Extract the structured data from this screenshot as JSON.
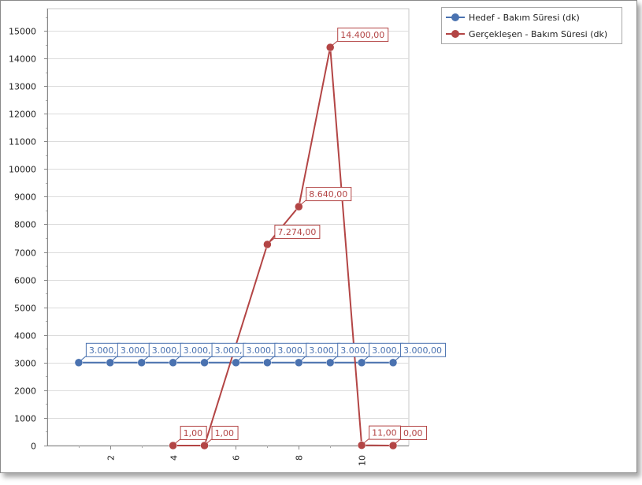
{
  "chart_data": {
    "type": "line",
    "title": "",
    "xlabel": "",
    "ylabel": "",
    "xlim": [
      0,
      11.5
    ],
    "ylim": [
      0,
      15800
    ],
    "y_ticks": [
      0,
      1000,
      2000,
      3000,
      4000,
      5000,
      6000,
      7000,
      8000,
      9000,
      10000,
      11000,
      12000,
      13000,
      14000,
      15000
    ],
    "x_ticks": [
      2,
      4,
      6,
      8,
      10
    ],
    "grid": true,
    "legend_position": "top-right",
    "series": [
      {
        "name": "Hedef - Bakım Süresi (dk)",
        "color": "#4a72b0",
        "x": [
          1,
          2,
          3,
          4,
          5,
          6,
          7,
          8,
          9,
          10,
          11
        ],
        "y": [
          3000,
          3000,
          3000,
          3000,
          3000,
          3000,
          3000,
          3000,
          3000,
          3000,
          3000
        ],
        "labels": [
          "3.000,",
          "3.000,",
          "3.000,",
          "3.000,",
          "3.000,",
          "3.000,",
          "3.000,",
          "3.000,",
          "3.000,",
          "3.000,",
          "3.000,00"
        ]
      },
      {
        "name": "Gerçekleşen - Bakım Süresi (dk)",
        "color": "#b34545",
        "x": [
          4,
          5,
          7,
          8,
          9,
          10,
          11
        ],
        "y": [
          1,
          1,
          7274,
          8640,
          14400,
          11,
          0
        ],
        "labels": [
          "1,00",
          "1,00",
          "7.274,00",
          "8.640,00",
          "14.400,00",
          "11,00",
          "0,00"
        ]
      }
    ]
  }
}
